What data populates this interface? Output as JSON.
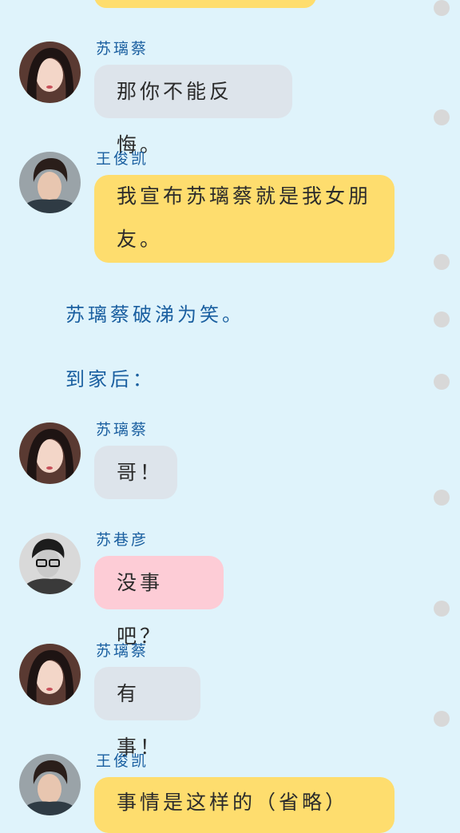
{
  "messages": [
    {
      "speaker": "苏璃蔡",
      "text": "那你不能反悔。"
    },
    {
      "speaker": "王俊凯",
      "text_line1": "我宣布苏璃蔡就是我女朋",
      "text_line2": "友。"
    },
    {
      "speaker": "苏璃蔡",
      "text": "哥！"
    },
    {
      "speaker": "苏巷彦",
      "text": "没事吧？"
    },
    {
      "speaker": "苏璃蔡",
      "text": "有事！"
    },
    {
      "speaker": "王俊凯",
      "text": "事情是这样的（省略）"
    }
  ],
  "narration": [
    "苏璃蔡破涕为笑。",
    "到家后："
  ],
  "colors": {
    "background": "#dff3fb",
    "bubble_gray": "#dde4eb",
    "bubble_yellow": "#fedd6e",
    "bubble_pink": "#fdccd6",
    "name_blue": "#1a5fa0",
    "timeline_dot": "#d8d8d8"
  },
  "avatars": {
    "girl": "girl-avatar-icon",
    "boy": "boy-avatar-icon",
    "brother": "brother-avatar-icon"
  }
}
